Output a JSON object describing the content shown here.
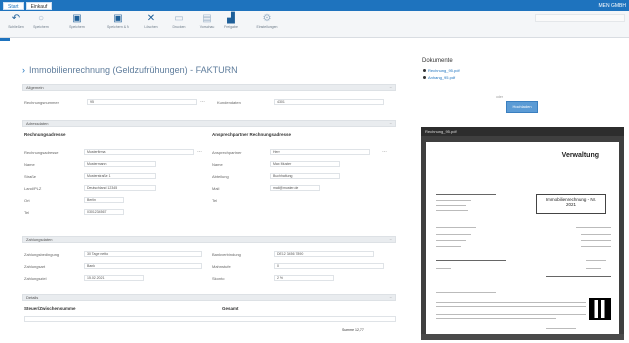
{
  "topbar": {
    "tabs": [
      "Start",
      "Einkauf"
    ],
    "right_text": "MEN GMBH"
  },
  "ribbon": {
    "buttons": [
      "Schließen",
      "Speichern",
      "Speichern",
      "Speichern & Neu",
      "Löschen",
      "Drucken",
      "Vorschau",
      "Freigabe",
      "Einstellungen"
    ]
  },
  "page": {
    "title": "Immobilienrechnung (Geldzufrühungen) - FAKTURN"
  },
  "sections": {
    "s1": "Allgemein",
    "s2": "Adressdaten",
    "s3": "Zahlungsdaten",
    "s4": "Details"
  },
  "fields": {
    "l1": "Rechnungsnummer",
    "v1": "95",
    "l2": "Kundendaten",
    "v2": "4301",
    "addr_left_head": "Rechnungsadresse",
    "addr_right_head": "Ansprechpartner Rechnungsadresse",
    "al": [
      "Rechnungsadresse",
      "Name",
      "Straße",
      "Land/PLZ",
      "Ort",
      "Tel"
    ],
    "av": [
      "Musterfirma",
      "Mustermann",
      "Musterstraße 1",
      "Deutschland 12345",
      "Berlin",
      "0301234567"
    ],
    "ar": [
      "Ansprechpartner",
      "Name",
      "Abteilung",
      "Mail",
      "Tel"
    ],
    "arv": [
      "Herr",
      "Max Muster",
      "Buchhaltung",
      "mail@muster.de",
      ""
    ],
    "pl": [
      "Zahlungsbedingung",
      "Zahlungsart",
      "Zahlungsziel"
    ],
    "pv": [
      "30 Tage netto",
      "Bank",
      "15.02.2021"
    ],
    "pr": [
      "Bankverbindung",
      "Mahnstufe",
      "Skonto"
    ],
    "prv": [
      "DE12 3456 7890",
      "0",
      "2 %"
    ],
    "d_left": "Steuer/Zwischensumme",
    "d_right": "Gesamt",
    "sum": "Summe 12,77"
  },
  "right_panel": {
    "docs_title": "Dokumente",
    "docs": [
      "Rechnung_95.pdf",
      "Anhang_95.pdf"
    ],
    "upload_label": "oder",
    "upload_button": "Hochladen"
  },
  "preview": {
    "header": "Rechnung_95.pdf",
    "brand": "Verwaltung",
    "box_line1": "Immobilienrechnung - Nr.",
    "box_line2": "2021"
  }
}
